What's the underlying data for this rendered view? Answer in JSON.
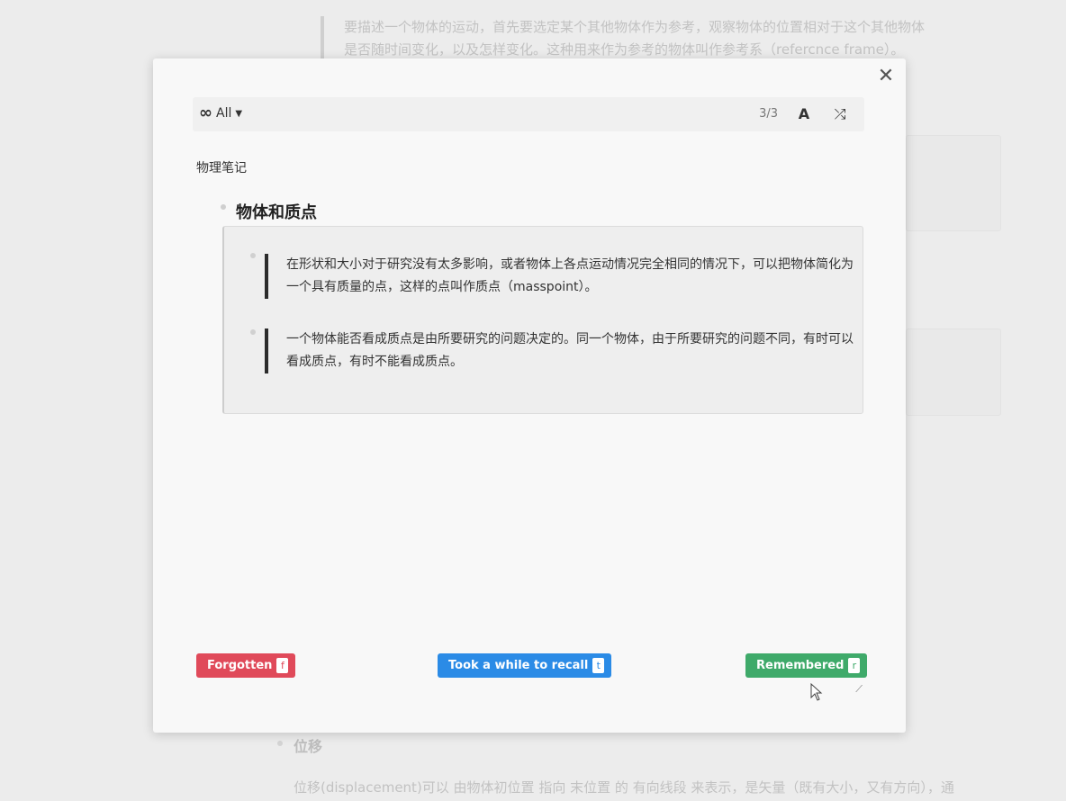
{
  "background": {
    "quote_line1": "要描述一个物体的运动，首先要选定某个其他物体作为参考，观察物体的位置相对于这个其他物体",
    "quote_line2": "是否随时间变化，以及怎样变化。这种用来作为参考的物体叫作参考系（refercnce frame）。",
    "heading": "位移",
    "paragraph": "位移(displacement)可以 由物体初位置 指向 末位置 的 有向线段 来表示，是矢量（既有大小，又有方向），通"
  },
  "modal": {
    "close_symbol": "✕",
    "toolbar": {
      "filter_icon": "infinity-icon",
      "filter_label": "All",
      "counter": "3/3",
      "font_icon": "font-icon",
      "font_glyph": "A",
      "shuffle_icon": "shuffle-icon",
      "shuffle_glyph": "⤮"
    },
    "deck_title": "物理笔记",
    "card_title": "物体和质点",
    "points": [
      "在形状和大小对于研究没有太多影响，或者物体上各点运动情况完全相同的情况下，可以把物体简化为一个具有质量的点，这样的点叫作质点（masspoint）。",
      "一个物体能否看成质点是由所要研究的问题决定的。同一个物体，由于所要研究的问题不同，有时可以看成质点，有时不能看成质点。"
    ],
    "buttons": {
      "forgotten": {
        "label": "Forgotten",
        "key": "f",
        "color": "#e04a5a"
      },
      "recall": {
        "label": "Took a while to recall",
        "key": "t",
        "color": "#2b8be6"
      },
      "remembered": {
        "label": "Remembered",
        "key": "r",
        "color": "#3faa6a"
      }
    }
  }
}
